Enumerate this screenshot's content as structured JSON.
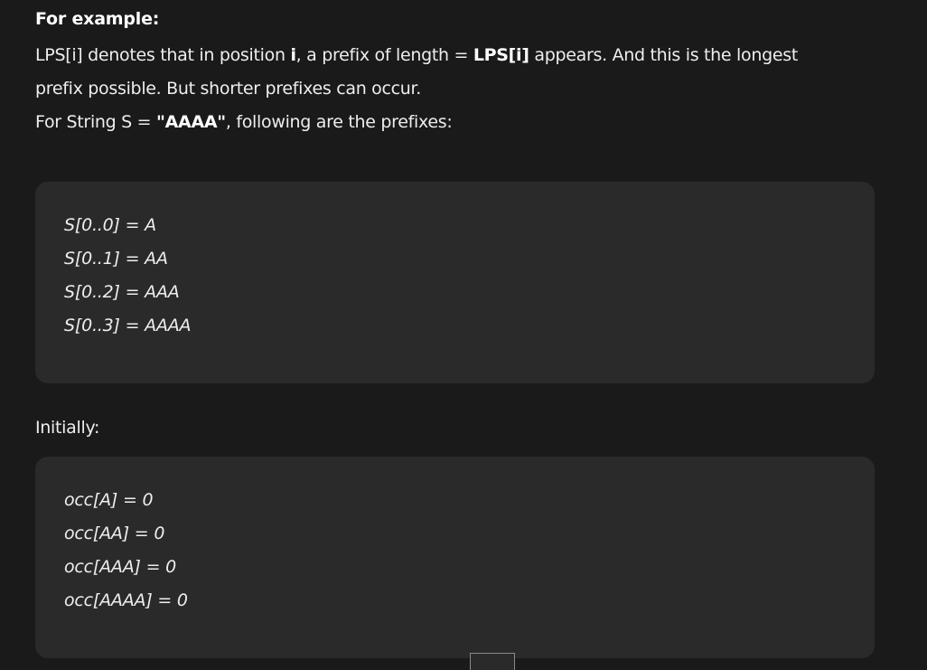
{
  "example": {
    "heading": "For example:",
    "line1": {
      "t1": "LPS[i] denotes that in position ",
      "b1": "i",
      "t2": ", a prefix of length = ",
      "b2": "LPS[i]",
      "t3": " appears. And this is the longest"
    },
    "line2": "prefix possible. But shorter prefixes can occur.",
    "line3": {
      "t1": "For String S = ",
      "b1": "\"AAAA\"",
      "t2": ", following are the prefixes:"
    }
  },
  "prefixes_box": {
    "lines": [
      "S[0..0] = A",
      "S[0..1] = AA",
      "S[0..2] = AAA",
      "S[0..3] = AAAA"
    ]
  },
  "initially_label": "Initially:",
  "occ_box": {
    "lines": [
      "occ[A] = 0",
      "occ[AA] = 0",
      "occ[AAA] = 0",
      "occ[AAAA] = 0"
    ]
  }
}
